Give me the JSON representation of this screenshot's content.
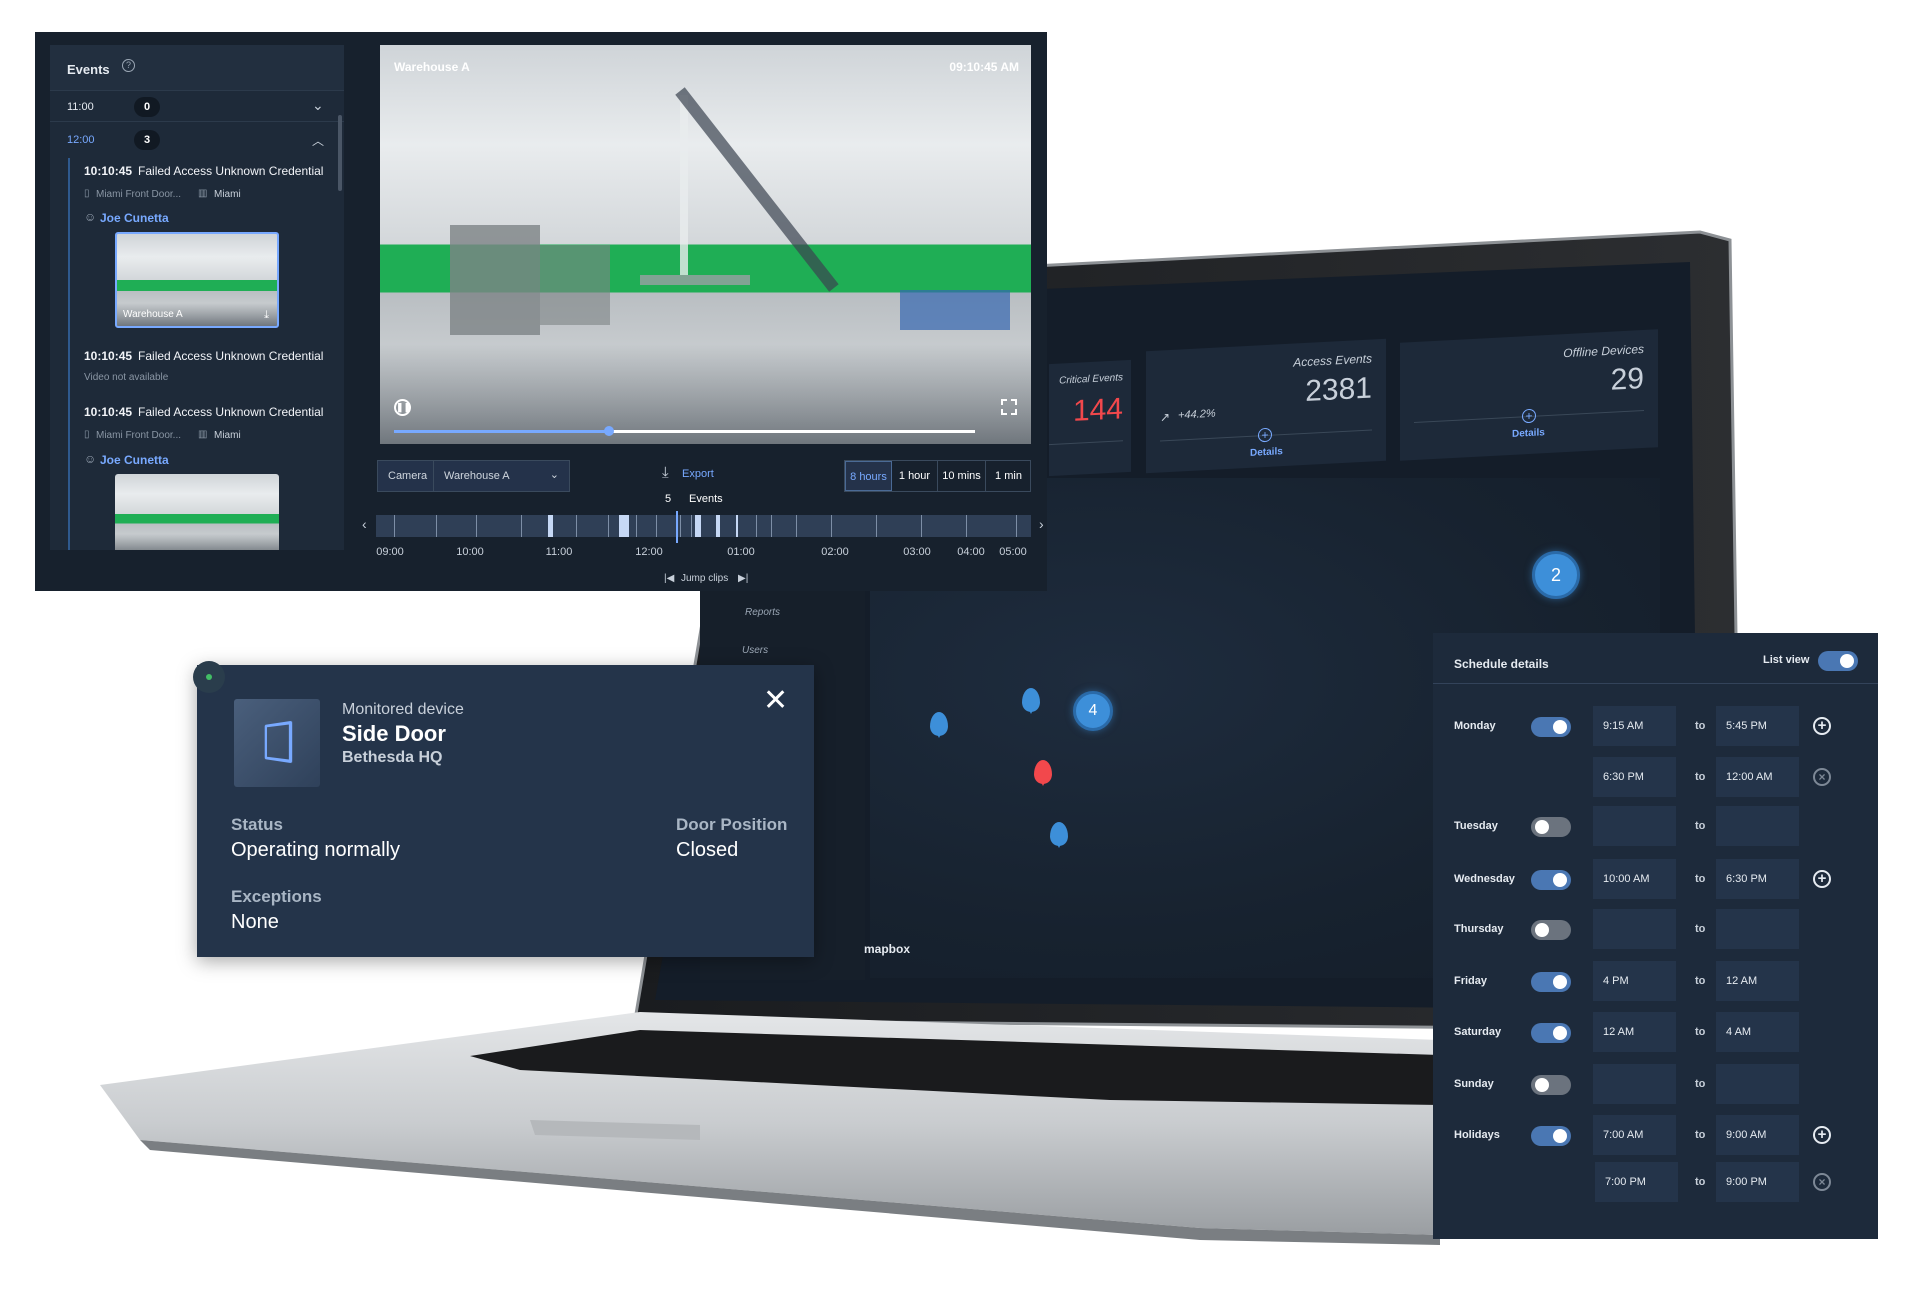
{
  "colors": {
    "accent": "#78a9ff",
    "critical": "#f2484c",
    "toggle_on": "#4a77b3",
    "panel": "#1d2a3b",
    "video_floor_band": "#1fae55"
  },
  "dashboard": {
    "kpis": [
      {
        "label": "Critical Events",
        "value": "144"
      },
      {
        "label": "Access Events",
        "value": "2381",
        "trend": "+44.2%",
        "details": "Details",
        "trend_icon": "trend-up-icon"
      },
      {
        "label": "Offline Devices",
        "value": "29",
        "details": "Details"
      }
    ],
    "nav": [
      {
        "label": "Reports",
        "icon": "reports-icon"
      },
      {
        "label": "Users",
        "icon": "user-icon"
      }
    ],
    "map": {
      "clusters": [
        "2",
        "4"
      ],
      "attribution": "mapbox"
    }
  },
  "events": {
    "title": "Events",
    "groups": [
      {
        "time": "11:00",
        "count": "0",
        "expanded": false
      },
      {
        "time": "12:00",
        "count": "3",
        "expanded": true
      }
    ],
    "items": [
      {
        "time": "10:10:45",
        "title": "Failed Access Unknown Credential",
        "door": "Miami Front Door...",
        "site": "Miami",
        "user": "Joe Cunetta",
        "thumb_label": "Warehouse A"
      },
      {
        "time": "10:10:45",
        "title": "Failed Access Unknown Credential",
        "note": "Video not available"
      },
      {
        "time": "10:10:45",
        "title": "Failed Access Unknown Credential",
        "door": "Miami Front Door...",
        "site": "Miami",
        "user": "Joe Cunetta"
      }
    ]
  },
  "video": {
    "camera_name": "Warehouse A",
    "timestamp": "09:10:45 AM",
    "progress_percent": 37
  },
  "controls": {
    "camera_label": "Camera",
    "camera_value": "Warehouse A",
    "export_label": "Export",
    "ranges": [
      "8 hours",
      "1 hour",
      "10 mins",
      "1 min"
    ],
    "selected_range": "8 hours",
    "event_count": "5",
    "event_label": "Events",
    "timeline_ticks": [
      "09:00",
      "10:00",
      "11:00",
      "12:00",
      "01:00",
      "02:00",
      "03:00",
      "04:00",
      "05:00"
    ],
    "jump_label": "Jump clips"
  },
  "device": {
    "kind": "Monitored device",
    "name": "Side Door",
    "location": "Bethesda HQ",
    "status_label": "Status",
    "status": "Operating normally",
    "position_label": "Door Position",
    "position": "Closed",
    "exceptions_label": "Exceptions",
    "exceptions": "None"
  },
  "schedule": {
    "title": "Schedule details",
    "list_view_label": "List view",
    "list_view_on": true,
    "to": "to",
    "rows": [
      {
        "day": "Monday",
        "on": true,
        "from": "9:15 AM",
        "until": "5:45 PM",
        "action": "add"
      },
      {
        "day": "",
        "on": null,
        "from": "6:30 PM",
        "until": "12:00 AM",
        "action": "remove"
      },
      {
        "day": "Tuesday",
        "on": false,
        "from": "",
        "until": "",
        "action": ""
      },
      {
        "day": "Wednesday",
        "on": true,
        "from": "10:00 AM",
        "until": "6:30 PM",
        "action": "add"
      },
      {
        "day": "Thursday",
        "on": false,
        "from": "",
        "until": "",
        "action": ""
      },
      {
        "day": "Friday",
        "on": true,
        "from": "4 PM",
        "until": "12 AM",
        "action": ""
      },
      {
        "day": "Saturday",
        "on": true,
        "from": "12 AM",
        "until": "4 AM",
        "action": ""
      },
      {
        "day": "Sunday",
        "on": false,
        "from": "",
        "until": "",
        "action": ""
      },
      {
        "day": "Holidays",
        "on": true,
        "from": "7:00 AM",
        "until": "9:00 AM",
        "action": "add"
      },
      {
        "day": "",
        "on": null,
        "from": "7:00 PM",
        "until": "9:00 PM",
        "action": "remove"
      }
    ]
  }
}
